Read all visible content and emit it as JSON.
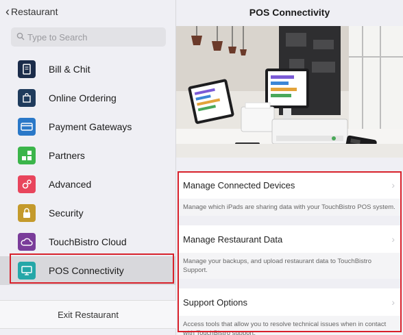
{
  "nav": {
    "back_label": "Restaurant"
  },
  "search": {
    "placeholder": "Type to Search"
  },
  "sidebar": {
    "items": [
      {
        "label": "Bill & Chit",
        "icon": "receipt-icon",
        "color": "#1b2c4a"
      },
      {
        "label": "Online Ordering",
        "icon": "shopping-bag-icon",
        "color": "#1f3b5c"
      },
      {
        "label": "Payment Gateways",
        "icon": "credit-card-icon",
        "color": "#2a78c8"
      },
      {
        "label": "Partners",
        "icon": "partners-grid-icon",
        "color": "#3bb54a"
      },
      {
        "label": "Advanced",
        "icon": "gears-icon",
        "color": "#e8455c"
      },
      {
        "label": "Security",
        "icon": "lock-icon",
        "color": "#c49a2c"
      },
      {
        "label": "TouchBistro Cloud",
        "icon": "cloud-icon",
        "color": "#7a3c9a"
      },
      {
        "label": "POS Connectivity",
        "icon": "monitor-icon",
        "color": "#25a7a8"
      }
    ],
    "active_index": 7,
    "exit_label": "Exit Restaurant"
  },
  "main": {
    "title": "POS Connectivity",
    "rows": [
      {
        "title": "Manage Connected Devices",
        "description": "Manage which iPads are sharing data with your TouchBistro POS system."
      },
      {
        "title": "Manage Restaurant Data",
        "description": "Manage your backups, and upload restaurant data to TouchBistro Support."
      },
      {
        "title": "Support Options",
        "description": "Access tools that allow you to resolve technical issues when in contact with TouchBistro support."
      }
    ]
  },
  "colors": {
    "highlight": "#d8202a"
  }
}
